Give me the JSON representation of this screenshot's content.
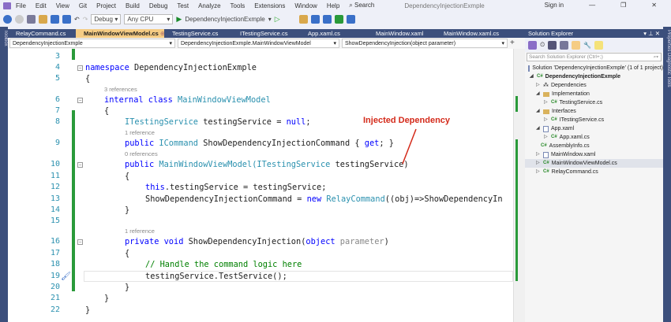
{
  "menu": {
    "items": [
      "File",
      "Edit",
      "View",
      "Git",
      "Project",
      "Build",
      "Debug",
      "Test",
      "Analyze",
      "Tools",
      "Extensions",
      "Window",
      "Help"
    ],
    "search": "Search",
    "title": "DependencyInjectionExmple",
    "sign_in": "Sign in"
  },
  "toolbar": {
    "config": "Debug",
    "platform": "Any CPU",
    "run_target": "DependencyInjectionExmple"
  },
  "side": {
    "left": "Toolbox",
    "right": "Properties   Diagnostic Tools"
  },
  "tabs": [
    "RelayCommand.cs",
    "MainWindowViewModel.cs",
    "TestingService.cs",
    "ITestingService.cs",
    "App.xaml.cs",
    "MainWindow.xaml",
    "MainWindow.xaml.cs"
  ],
  "navbar": {
    "project": "DependencyInjectionExmple",
    "class": "DependencyInjectionExmple.MainWindowViewModel",
    "member": "ShowDependencyInjection(object parameter)"
  },
  "annotation": "Injected Dependency",
  "code": {
    "l3": "3",
    "l4": "4",
    "l5": "5",
    "l6": "6",
    "l7": "7",
    "l8": "8",
    "l9": "9",
    "l10": "10",
    "l11": "11",
    "l12": "12",
    "l13": "13",
    "l14": "14",
    "l15": "15",
    "l16": "16",
    "l17": "17",
    "l18": "18",
    "l19": "19",
    "l20": "20",
    "l21": "21",
    "l22": "22",
    "ref3": "3 references",
    "ref1a": "1 reference",
    "ref0": "0 references",
    "ref1b": "1 reference",
    "ns_kw": "namespace",
    "ns_name": " DependencyInjectionExmple",
    "brace_open": "{",
    "brace_close": "}",
    "cls_kw": "internal class",
    "cls_name": " MainWindowViewModel",
    "f_type": "ITestingService",
    "f_rest": " testingService = ",
    "f_null": "null",
    "semi": ";",
    "p_kw": "public",
    "p_type": " ICommand",
    "p_rest": " ShowDependencyInjectionCommand { ",
    "p_get": "get",
    "p_end": "; }",
    "c_kw": "public",
    "c_type": " MainWindowViewModel(",
    "c_ptype": "ITestingService",
    "c_rest": " testingService)",
    "this_kw": "this",
    ".": ".",
    "assign": ".testingService = testingService;",
    "cmd_rest": "ShowDependencyInjectionCommand = ",
    "new_kw": "new",
    "relay": " RelayCommand",
    "relay_rest": "((obj)=>ShowDependencyIn",
    "m_kw": "private void",
    "m_name": " ShowDependencyInjection(",
    "m_obj": "object",
    "m_param": " parameter",
    ")": ")",
    "comment": "// Handle the command logic here",
    "call": "testingService.TestService();"
  },
  "solution_explorer": {
    "title": "Solution Explorer",
    "search_placeholder": "Search Solution Explorer (Ctrl+;)",
    "items": [
      "Solution 'DependencyInjectionExmple' (1 of 1 project)",
      "DependencyInjectionExmple",
      "Dependencies",
      "Implementation",
      "TestingService.cs",
      "Interfaces",
      "ITestingService.cs",
      "App.xaml",
      "App.xaml.cs",
      "AssemblyInfo.cs",
      "MainWindow.xaml",
      "MainWindowViewModel.cs",
      "RelayCommand.cs"
    ],
    "cs_badge": "C#"
  }
}
